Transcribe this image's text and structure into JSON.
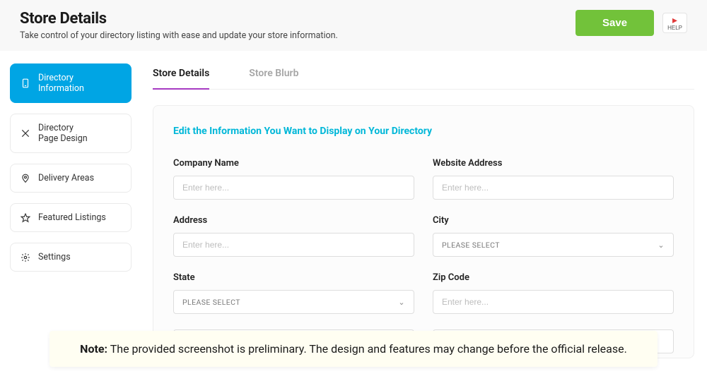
{
  "header": {
    "title": "Store Details",
    "subtitle": "Take control of your directory listing with ease and update your store information.",
    "save_label": "Save",
    "help_label": "HELP"
  },
  "sidebar": {
    "items": [
      {
        "label": "Directory\nInformation",
        "active": true
      },
      {
        "label": "Directory\nPage Design",
        "active": false
      },
      {
        "label": "Delivery Areas",
        "active": false
      },
      {
        "label": "Featured Listings",
        "active": false
      },
      {
        "label": "Settings",
        "active": false
      }
    ]
  },
  "tabs": [
    {
      "label": "Store Details",
      "active": true
    },
    {
      "label": "Store Blurb",
      "active": false
    }
  ],
  "panel": {
    "title": "Edit the Information You Want to Display on Your Directory",
    "fields": {
      "company_name": {
        "label": "Company Name",
        "placeholder": "Enter here..."
      },
      "website": {
        "label": "Website Address",
        "placeholder": "Enter here..."
      },
      "address": {
        "label": "Address",
        "placeholder": "Enter here..."
      },
      "city": {
        "label": "City",
        "selected": "PLEASE SELECT"
      },
      "state": {
        "label": "State",
        "selected": "PLEASE SELECT"
      },
      "zip": {
        "label": "Zip Code",
        "placeholder": "Enter here..."
      }
    }
  },
  "note": {
    "prefix": "Note:",
    "text": " The provided screenshot is preliminary. The design and features may change before the official release."
  },
  "colors": {
    "accent_sidebar": "#00a5e4",
    "accent_tab": "#a63ac2",
    "save_button": "#72c23a",
    "panel_title": "#00b7d8"
  }
}
